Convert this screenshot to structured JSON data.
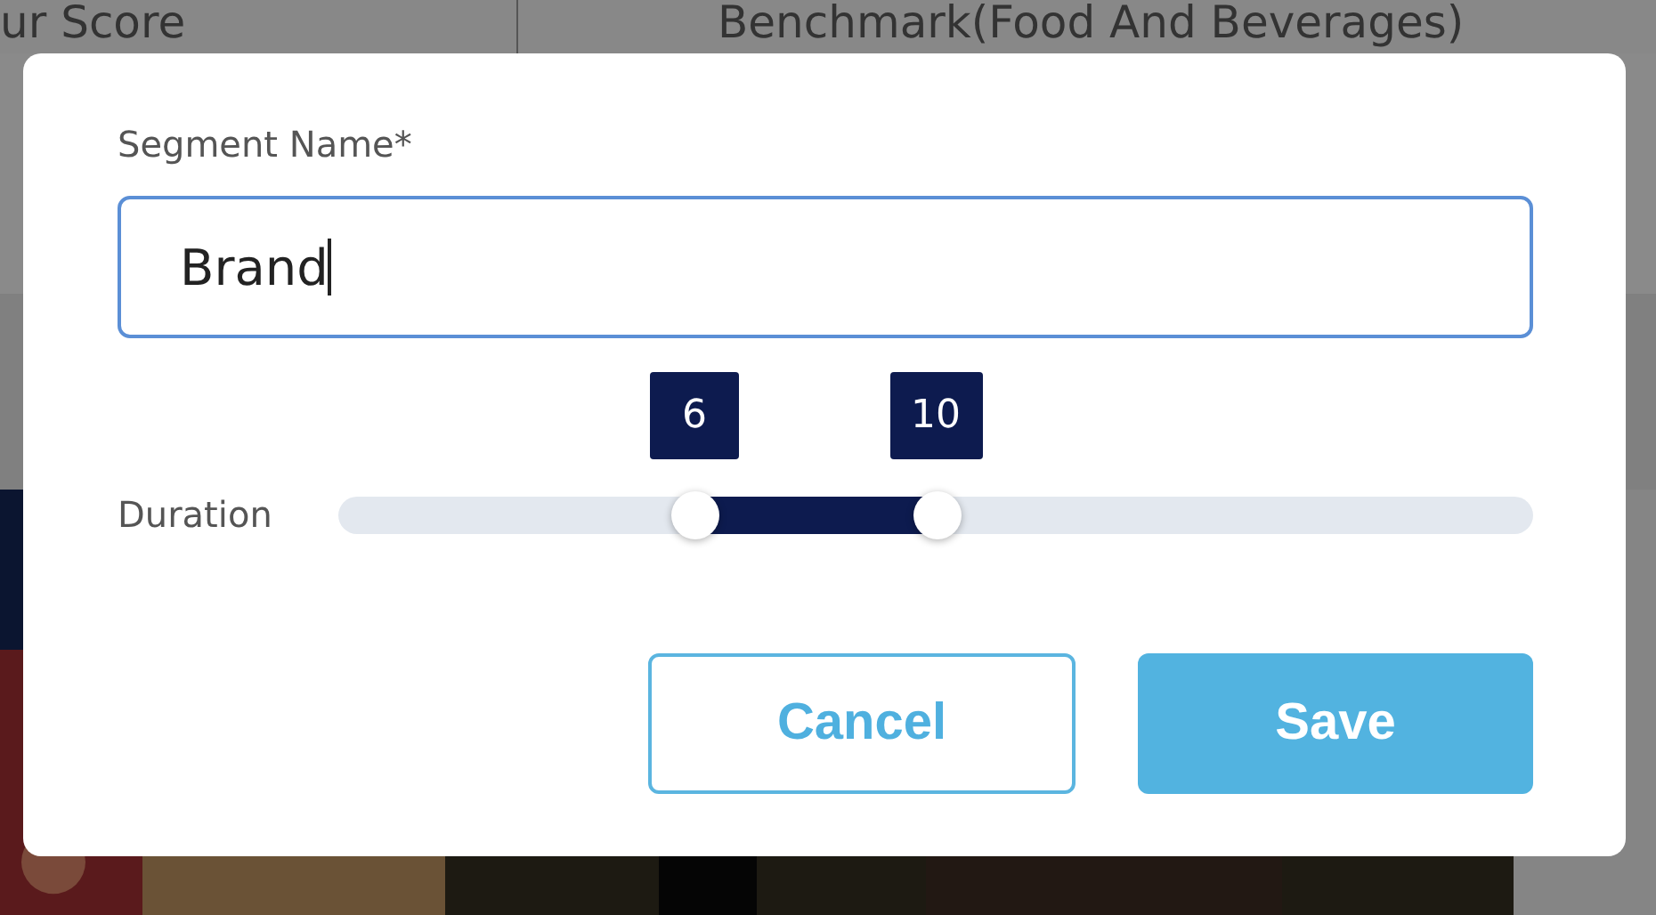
{
  "background": {
    "columns": [
      "ur Score",
      "Benchmark(Food And Beverages)"
    ]
  },
  "dialog": {
    "field": {
      "label": "Segment Name*",
      "value": "Brand",
      "focused": true
    },
    "duration": {
      "label": "Duration",
      "handles": [
        {
          "value": "6",
          "level": 0.298
        },
        {
          "value": "10",
          "level": 0.5
        }
      ]
    },
    "buttons": [
      {
        "label": "Cancel",
        "kind": "outline"
      },
      {
        "label": "Save",
        "kind": "primary"
      }
    ]
  }
}
